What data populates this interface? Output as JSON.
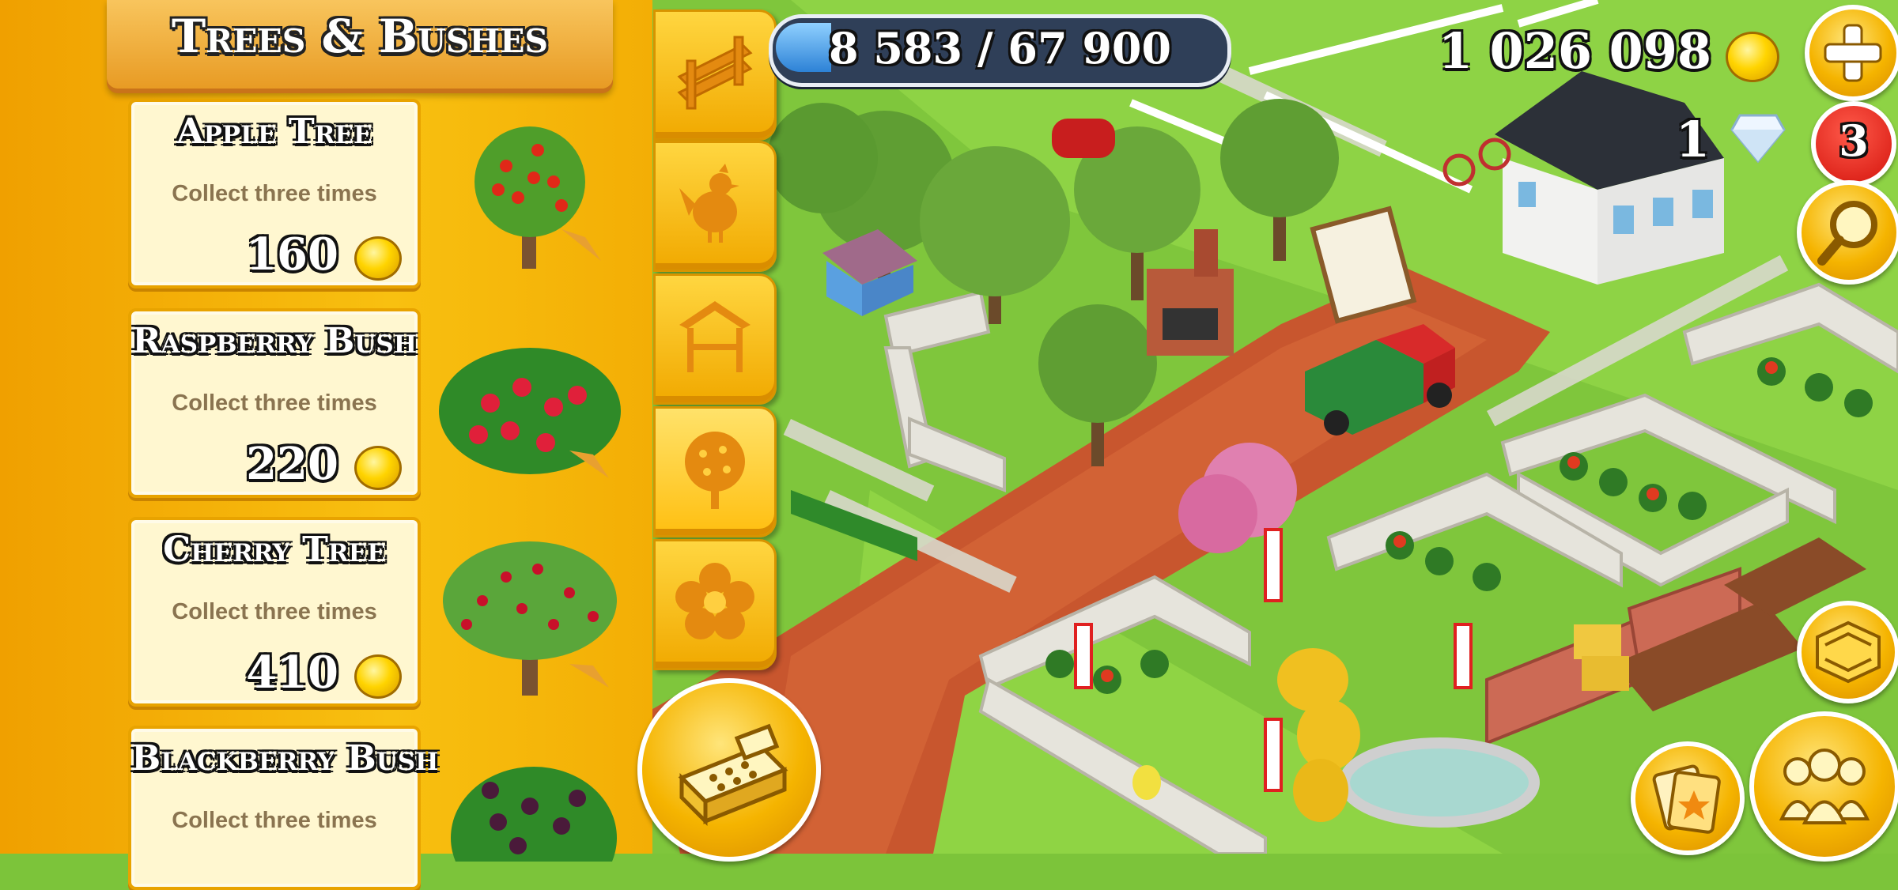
{
  "shop": {
    "title": "Trees & Bushes",
    "items": [
      {
        "name": "Apple Tree",
        "description": "Collect three times",
        "price": "160"
      },
      {
        "name": "Raspberry Bush",
        "description": "Collect three times",
        "price": "220"
      },
      {
        "name": "Cherry Tree",
        "description": "Collect three times",
        "price": "410"
      },
      {
        "name": "Blackberry Bush",
        "description": "Collect three times",
        "price": ""
      }
    ],
    "tabs": [
      {
        "icon": "fence-icon",
        "active": false
      },
      {
        "icon": "rooster-icon",
        "active": false
      },
      {
        "icon": "stand-icon",
        "active": false
      },
      {
        "icon": "tree-icon",
        "active": true
      },
      {
        "icon": "flower-icon",
        "active": false
      }
    ]
  },
  "hud": {
    "xp_text": "8 583 / 67 900",
    "xp_fraction": 0.126,
    "coins": "1 026 098",
    "diamonds": "1",
    "notifications": "3"
  },
  "buttons": {
    "add": "plus-icon",
    "search": "magnifier-icon",
    "expand": "expand-map-icon",
    "friends": "friends-icon",
    "cards": "cards-icon",
    "sell": "cash-register-icon"
  },
  "colors": {
    "panel": "#f8c010",
    "tab": "#ffbf10",
    "card": "#fff7d0",
    "xp_fill": "#2d82d6",
    "badge": "#d4140d",
    "grass": "#7cc43a",
    "road": "#c8562e"
  }
}
